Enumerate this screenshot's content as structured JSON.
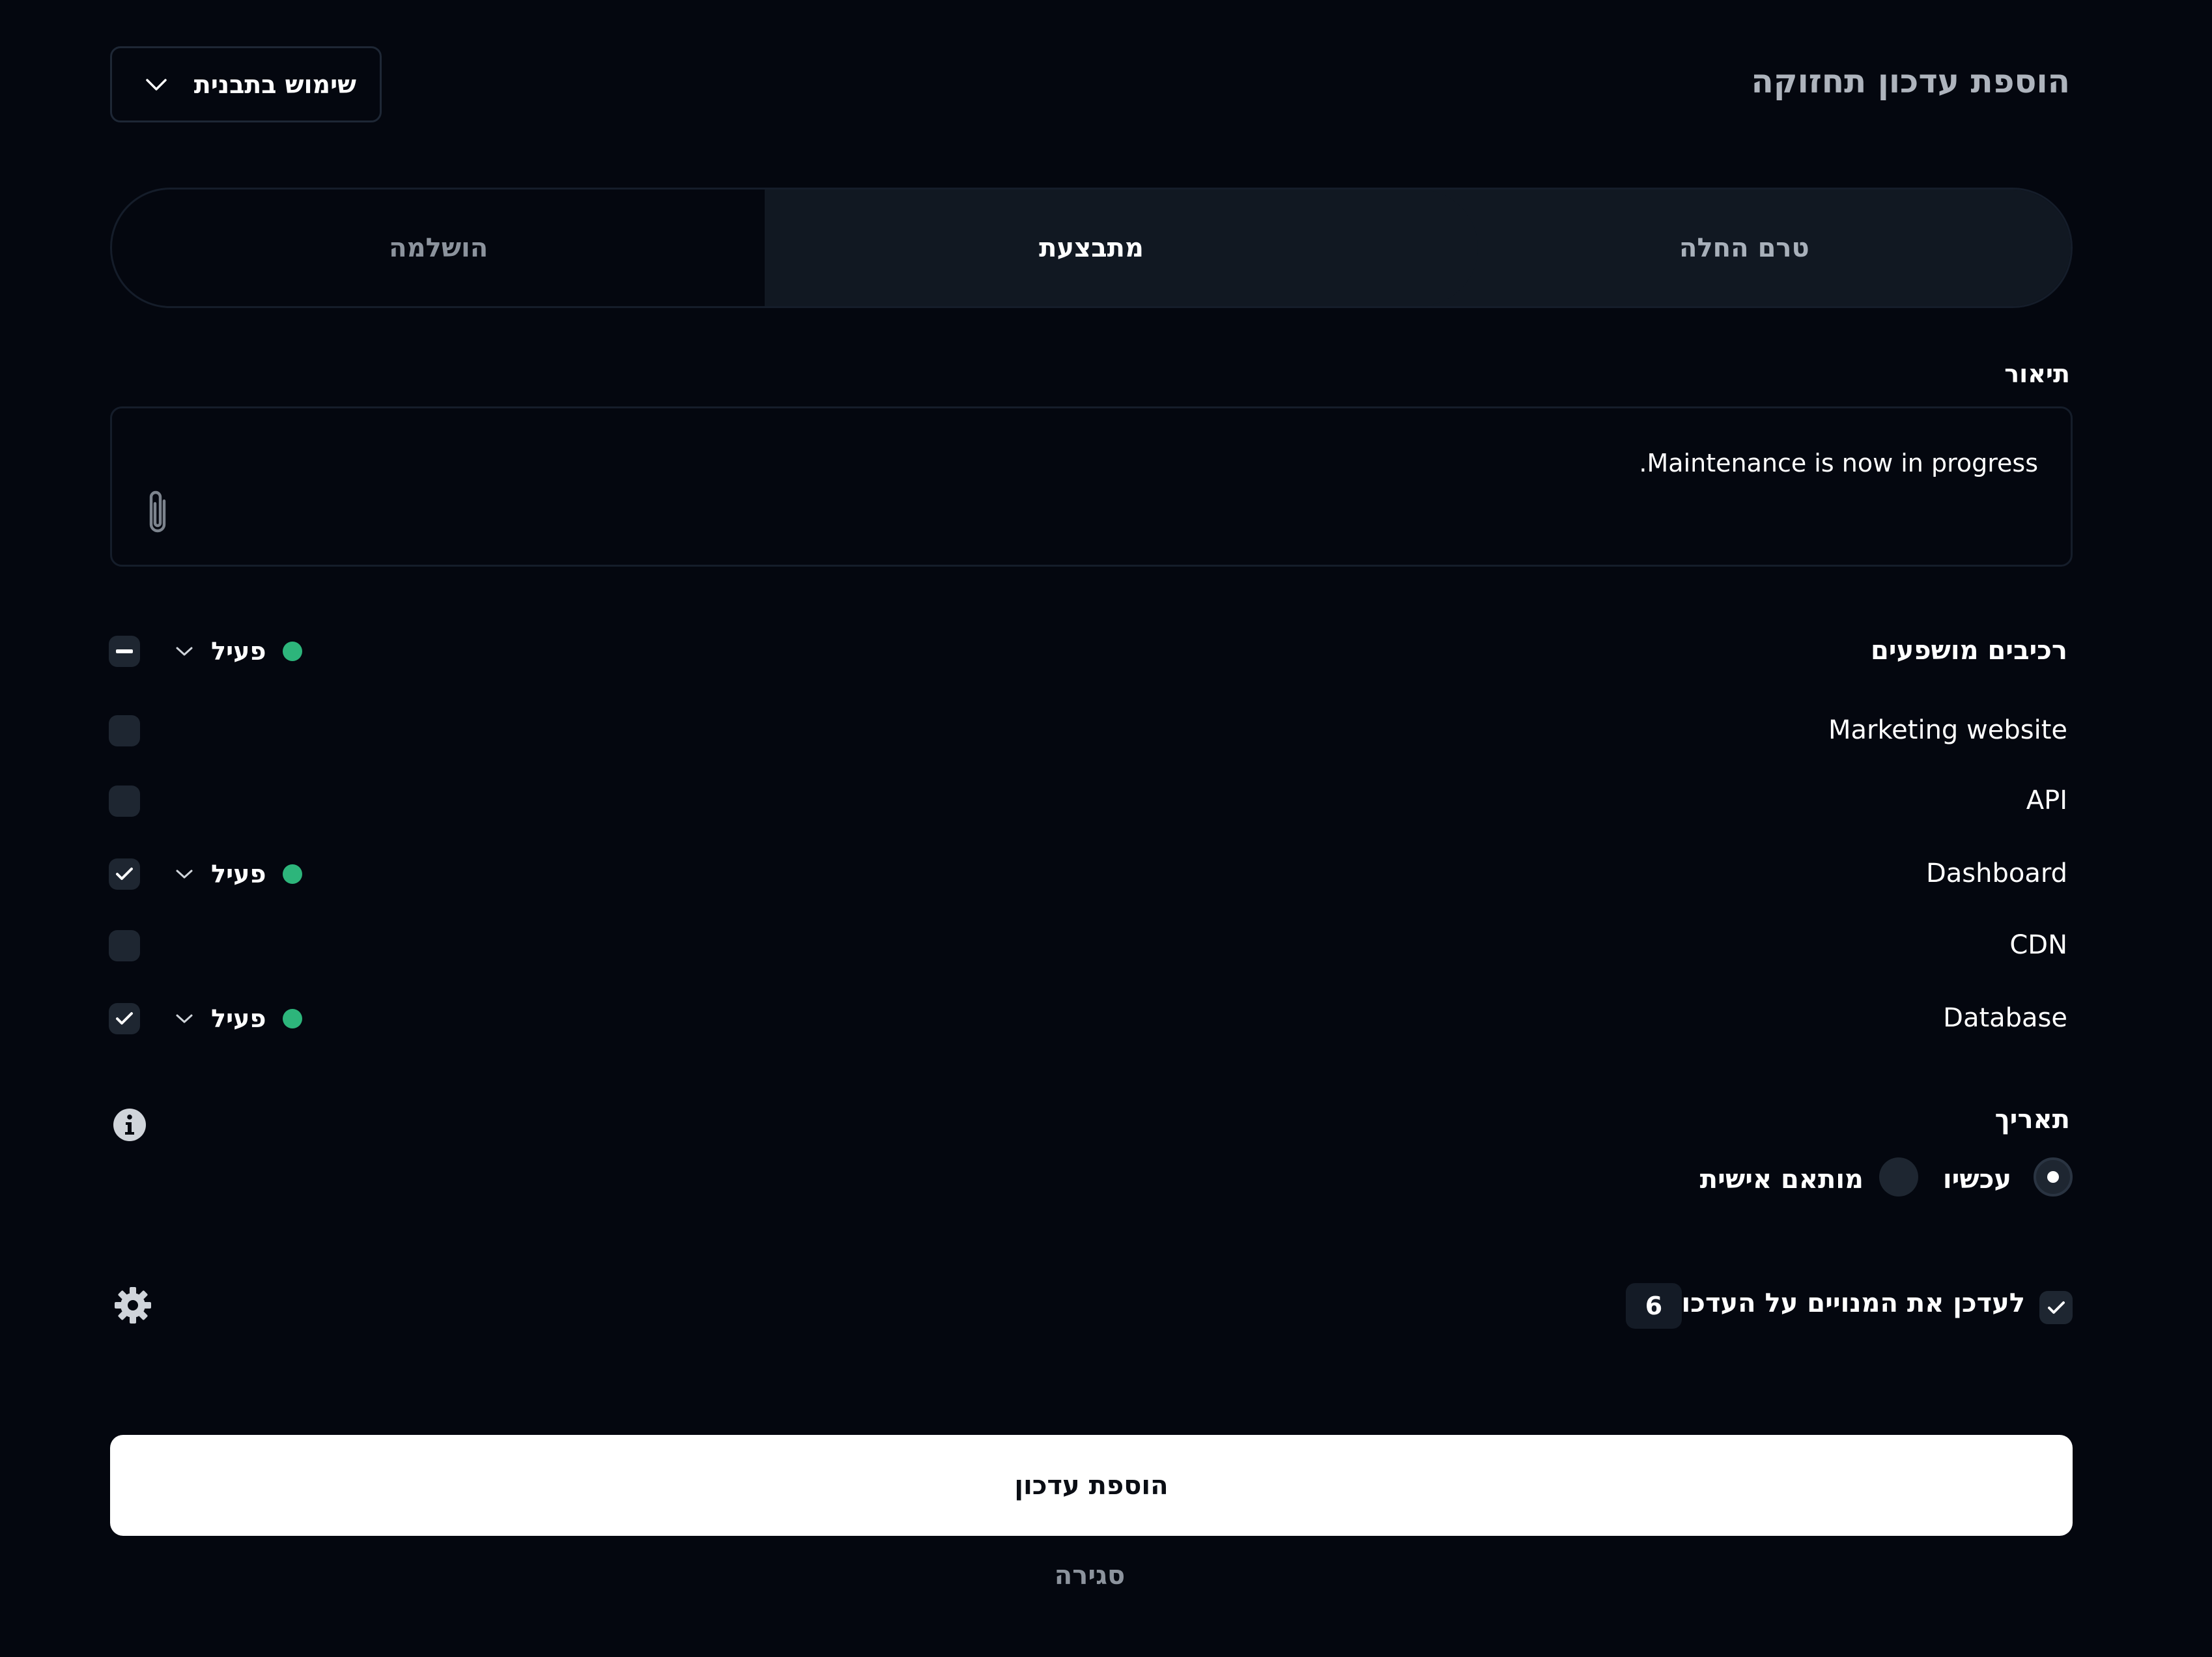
{
  "header": {
    "title": "הוספת עדכון תחזוקה",
    "template_button_label": "שימוש בתבנית"
  },
  "tabs": [
    {
      "label": "טרם החלה",
      "state": "done"
    },
    {
      "label": "מתבצעת",
      "state": "active"
    },
    {
      "label": "הושלמה",
      "state": "inactive"
    }
  ],
  "description": {
    "label": "תיאור",
    "value": "Maintenance is now in progress."
  },
  "components": {
    "heading": "רכיבים מושפעים",
    "heading_status": "פעיל",
    "items": [
      {
        "name": "Marketing website",
        "checked": false,
        "status": ""
      },
      {
        "name": "API",
        "checked": false,
        "status": ""
      },
      {
        "name": "Dashboard",
        "checked": true,
        "status": "פעיל"
      },
      {
        "name": "CDN",
        "checked": false,
        "status": ""
      },
      {
        "name": "Database",
        "checked": true,
        "status": "פעיל"
      }
    ]
  },
  "date": {
    "label": "תאריך",
    "options": [
      {
        "label": "עכשיו",
        "selected": true
      },
      {
        "label": "מותאם אישית",
        "selected": false
      }
    ]
  },
  "notify": {
    "label": "לעדכן את המנויים על העדכון",
    "count": "6",
    "checked": true
  },
  "actions": {
    "submit_label": "הוספת עדכון",
    "close_label": "סגירה"
  },
  "colors": {
    "background": "#04070f",
    "status_dot": "#2db57b",
    "primary_button": "#ffffff"
  }
}
